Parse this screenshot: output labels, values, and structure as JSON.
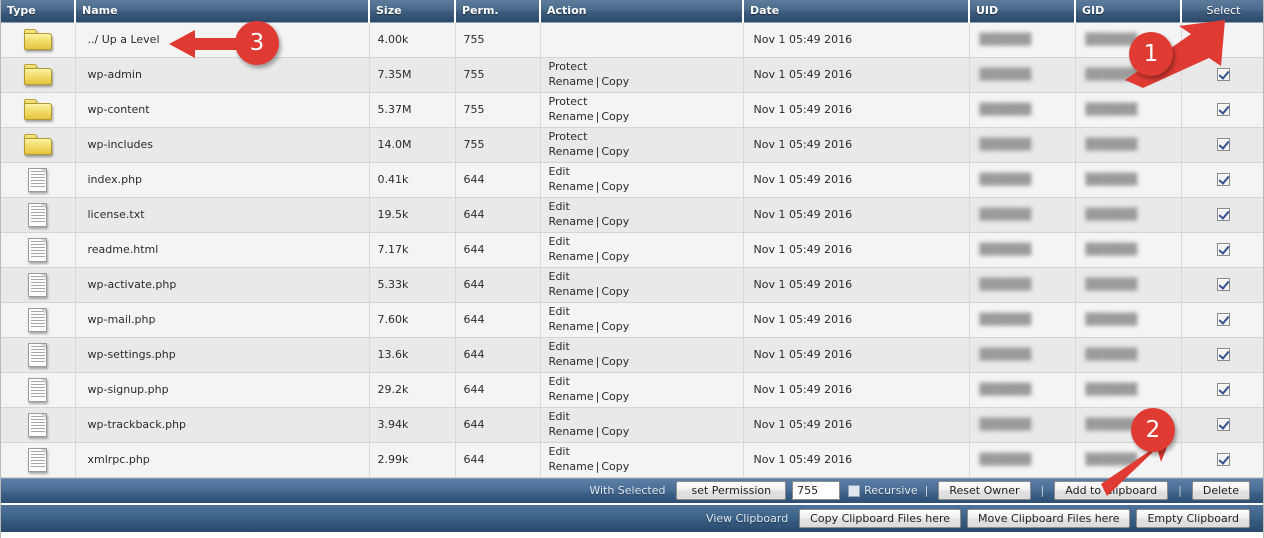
{
  "table": {
    "columns": [
      {
        "key": "type",
        "label": "Type"
      },
      {
        "key": "name",
        "label": "Name"
      },
      {
        "key": "size",
        "label": "Size"
      },
      {
        "key": "perm",
        "label": "Perm."
      },
      {
        "key": "action",
        "label": "Action"
      },
      {
        "key": "date",
        "label": "Date"
      },
      {
        "key": "uid",
        "label": "UID"
      },
      {
        "key": "gid",
        "label": "GID"
      },
      {
        "key": "select",
        "label": "Select"
      }
    ],
    "rows": [
      {
        "icon": "folder-icon",
        "name": "../ Up a Level",
        "size": "4.00k",
        "perm": "755",
        "action1": "",
        "action2a": "",
        "action2b": "",
        "date": "Nov 1 05:49 2016",
        "uid": "redacted",
        "gid": "redacted",
        "checked": false,
        "show_checkbox": false
      },
      {
        "icon": "folder-icon",
        "name": "wp-admin",
        "size": "7.35M",
        "perm": "755",
        "action1": "Protect",
        "action2a": "Rename",
        "action2b": "Copy",
        "date": "Nov 1 05:49 2016",
        "uid": "redacted",
        "gid": "redacted",
        "checked": true,
        "show_checkbox": true
      },
      {
        "icon": "folder-icon",
        "name": "wp-content",
        "size": "5.37M",
        "perm": "755",
        "action1": "Protect",
        "action2a": "Rename",
        "action2b": "Copy",
        "date": "Nov 1 05:49 2016",
        "uid": "redacted",
        "gid": "redacted",
        "checked": true,
        "show_checkbox": true
      },
      {
        "icon": "folder-icon",
        "name": "wp-includes",
        "size": "14.0M",
        "perm": "755",
        "action1": "Protect",
        "action2a": "Rename",
        "action2b": "Copy",
        "date": "Nov 1 05:49 2016",
        "uid": "redacted",
        "gid": "redacted",
        "checked": true,
        "show_checkbox": true
      },
      {
        "icon": "file-icon",
        "name": "index.php",
        "size": "0.41k",
        "perm": "644",
        "action1": "Edit",
        "action2a": "Rename",
        "action2b": "Copy",
        "date": "Nov 1 05:49 2016",
        "uid": "redacted",
        "gid": "redacted",
        "checked": true,
        "show_checkbox": true
      },
      {
        "icon": "file-icon",
        "name": "license.txt",
        "size": "19.5k",
        "perm": "644",
        "action1": "Edit",
        "action2a": "Rename",
        "action2b": "Copy",
        "date": "Nov 1 05:49 2016",
        "uid": "redacted",
        "gid": "redacted",
        "checked": true,
        "show_checkbox": true
      },
      {
        "icon": "file-icon",
        "name": "readme.html",
        "size": "7.17k",
        "perm": "644",
        "action1": "Edit",
        "action2a": "Rename",
        "action2b": "Copy",
        "date": "Nov 1 05:49 2016",
        "uid": "redacted",
        "gid": "redacted",
        "checked": true,
        "show_checkbox": true
      },
      {
        "icon": "file-icon",
        "name": "wp-activate.php",
        "size": "5.33k",
        "perm": "644",
        "action1": "Edit",
        "action2a": "Rename",
        "action2b": "Copy",
        "date": "Nov 1 05:49 2016",
        "uid": "redacted",
        "gid": "redacted",
        "checked": true,
        "show_checkbox": true
      },
      {
        "icon": "file-icon",
        "name": "wp-mail.php",
        "size": "7.60k",
        "perm": "644",
        "action1": "Edit",
        "action2a": "Rename",
        "action2b": "Copy",
        "date": "Nov 1 05:49 2016",
        "uid": "redacted",
        "gid": "redacted",
        "checked": true,
        "show_checkbox": true
      },
      {
        "icon": "file-icon",
        "name": "wp-settings.php",
        "size": "13.6k",
        "perm": "644",
        "action1": "Edit",
        "action2a": "Rename",
        "action2b": "Copy",
        "date": "Nov 1 05:49 2016",
        "uid": "redacted",
        "gid": "redacted",
        "checked": true,
        "show_checkbox": true
      },
      {
        "icon": "file-icon",
        "name": "wp-signup.php",
        "size": "29.2k",
        "perm": "644",
        "action1": "Edit",
        "action2a": "Rename",
        "action2b": "Copy",
        "date": "Nov 1 05:49 2016",
        "uid": "redacted",
        "gid": "redacted",
        "checked": true,
        "show_checkbox": true
      },
      {
        "icon": "file-icon",
        "name": "wp-trackback.php",
        "size": "3.94k",
        "perm": "644",
        "action1": "Edit",
        "action2a": "Rename",
        "action2b": "Copy",
        "date": "Nov 1 05:49 2016",
        "uid": "redacted",
        "gid": "redacted",
        "checked": true,
        "show_checkbox": true
      },
      {
        "icon": "file-icon",
        "name": "xmlrpc.php",
        "size": "2.99k",
        "perm": "644",
        "action1": "Edit",
        "action2a": "Rename",
        "action2b": "Copy",
        "date": "Nov 1 05:49 2016",
        "uid": "redacted",
        "gid": "redacted",
        "checked": true,
        "show_checkbox": true
      }
    ],
    "action_separator": "|"
  },
  "toolbar_primary": {
    "with_selected_label": "With Selected",
    "set_permission_label": "set Permission",
    "permission_value": "755",
    "recursive_label": "Recursive",
    "recursive_checked": false,
    "reset_owner_label": "Reset Owner",
    "add_to_clipboard_label": "Add to Clipboard",
    "delete_label": "Delete",
    "separator": "|"
  },
  "toolbar_secondary": {
    "view_clipboard_label": "View Clipboard",
    "copy_clipboard_label": "Copy Clipboard Files here",
    "move_clipboard_label": "Move Clipboard Files here",
    "empty_clipboard_label": "Empty Clipboard"
  },
  "annotations": {
    "color": "#e03b33",
    "items": [
      {
        "number": "1",
        "target": "select-column-header"
      },
      {
        "number": "2",
        "target": "add-to-clipboard-button"
      },
      {
        "number": "3",
        "target": "up-a-level-link"
      }
    ]
  }
}
